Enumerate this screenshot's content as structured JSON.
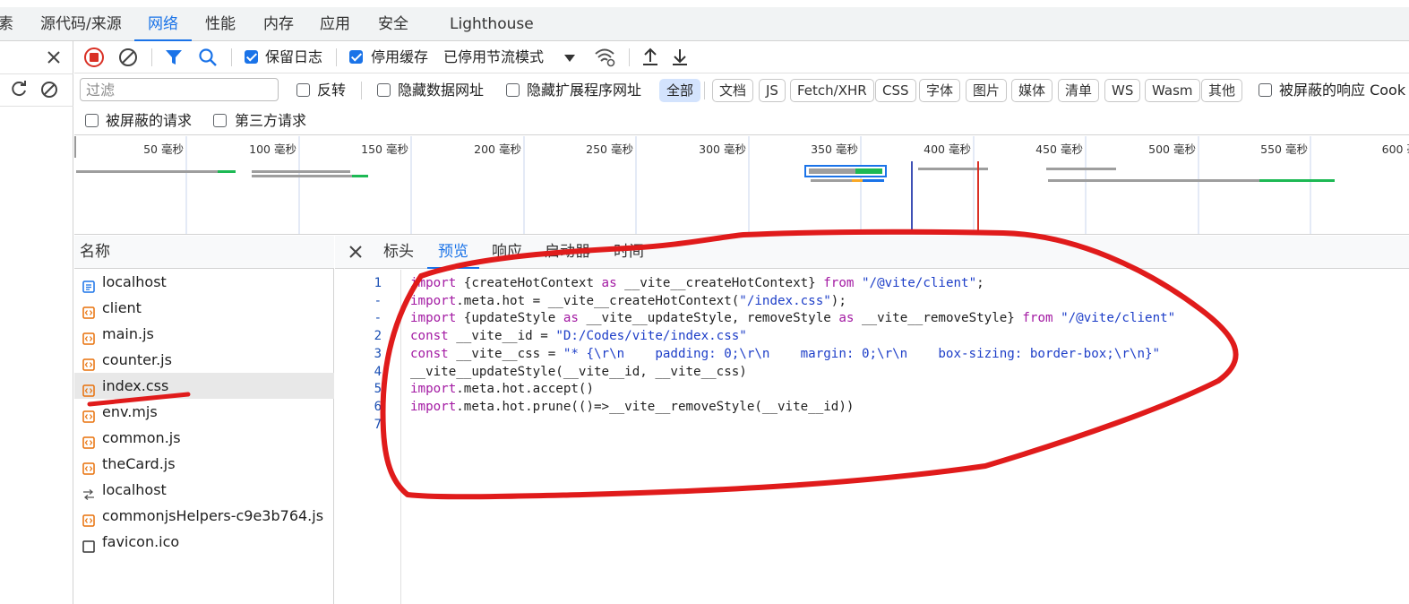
{
  "top_tabs": [
    {
      "label": "素"
    },
    {
      "label": "源代码/来源"
    },
    {
      "label": "网络"
    },
    {
      "label": "性能"
    },
    {
      "label": "内存"
    },
    {
      "label": "应用"
    },
    {
      "label": "安全"
    },
    {
      "label": "Lighthouse"
    }
  ],
  "toolbar": {
    "preserve_log": "保留日志",
    "disable_cache": "停用缓存",
    "throttling": "已停用节流模式"
  },
  "filter": {
    "placeholder": "过滤",
    "invert": "反转",
    "hide_data_urls": "隐藏数据网址",
    "hide_extension_urls": "隐藏扩展程序网址",
    "types": [
      "全部",
      "文档",
      "JS",
      "Fetch/XHR",
      "CSS",
      "字体",
      "图片",
      "媒体",
      "清单",
      "WS",
      "Wasm",
      "其他"
    ],
    "blocked_responses": "被屏蔽的响应 Cook",
    "blocked_requests": "被屏蔽的请求",
    "third_party": "第三方请求"
  },
  "timeline": {
    "ticks": [
      "50 毫秒",
      "100 毫秒",
      "150 毫秒",
      "200 毫秒",
      "250 毫秒",
      "300 毫秒",
      "350 毫秒",
      "400 毫秒",
      "450 毫秒",
      "500 毫秒",
      "550 毫秒",
      "600 毫"
    ]
  },
  "request_list": {
    "header": "名称",
    "rows": [
      {
        "name": "localhost",
        "icon": "document-icon"
      },
      {
        "name": "client",
        "icon": "script-icon"
      },
      {
        "name": "main.js",
        "icon": "script-icon"
      },
      {
        "name": "counter.js",
        "icon": "script-icon"
      },
      {
        "name": "index.css",
        "icon": "script-icon"
      },
      {
        "name": "env.mjs",
        "icon": "script-icon"
      },
      {
        "name": "common.js",
        "icon": "script-icon"
      },
      {
        "name": "theCard.js",
        "icon": "script-icon"
      },
      {
        "name": "localhost",
        "icon": "websocket-icon"
      },
      {
        "name": "commonjsHelpers-c9e3b764.js",
        "icon": "script-icon"
      },
      {
        "name": "favicon.ico",
        "icon": "blank-file-icon"
      }
    ]
  },
  "detail_tabs": [
    {
      "label": "标头"
    },
    {
      "label": "预览"
    },
    {
      "label": "响应"
    },
    {
      "label": "启动器"
    },
    {
      "label": "时间"
    }
  ],
  "code": {
    "line_numbers": [
      "1",
      "-",
      "-",
      "2",
      "3",
      "4",
      "5",
      "6",
      "7"
    ],
    "lines": [
      [
        {
          "t": "kw",
          "s": "import"
        },
        {
          "t": "",
          "s": " {createHotContext "
        },
        {
          "t": "kw",
          "s": "as"
        },
        {
          "t": "",
          "s": " __vite__createHotContext} "
        },
        {
          "t": "kw",
          "s": "from"
        },
        {
          "t": "",
          "s": " "
        },
        {
          "t": "str",
          "s": "\"/@vite/client\""
        },
        {
          "t": "",
          "s": ";"
        }
      ],
      [
        {
          "t": "kw",
          "s": "import"
        },
        {
          "t": "",
          "s": ".meta.hot = __vite__createHotContext("
        },
        {
          "t": "str",
          "s": "\"/index.css\""
        },
        {
          "t": "",
          "s": ");"
        }
      ],
      [
        {
          "t": "kw",
          "s": "import"
        },
        {
          "t": "",
          "s": " {updateStyle "
        },
        {
          "t": "kw",
          "s": "as"
        },
        {
          "t": "",
          "s": " __vite__updateStyle, removeStyle "
        },
        {
          "t": "kw",
          "s": "as"
        },
        {
          "t": "",
          "s": " __vite__removeStyle} "
        },
        {
          "t": "kw",
          "s": "from"
        },
        {
          "t": "",
          "s": " "
        },
        {
          "t": "str",
          "s": "\"/@vite/client\""
        }
      ],
      [
        {
          "t": "kw",
          "s": "const"
        },
        {
          "t": "",
          "s": " __vite__id = "
        },
        {
          "t": "str",
          "s": "\"D:/Codes/vite/index.css\""
        }
      ],
      [
        {
          "t": "kw",
          "s": "const"
        },
        {
          "t": "",
          "s": " __vite__css = "
        },
        {
          "t": "str",
          "s": "\"* {\\r\\n    padding: 0;\\r\\n    margin: 0;\\r\\n    box-sizing: border-box;\\r\\n}\""
        }
      ],
      [
        {
          "t": "",
          "s": "__vite__updateStyle(__vite__id, __vite__css)"
        }
      ],
      [
        {
          "t": "kw",
          "s": "import"
        },
        {
          "t": "",
          "s": ".meta.hot.accept()"
        }
      ],
      [
        {
          "t": "kw",
          "s": "import"
        },
        {
          "t": "",
          "s": ".meta.hot.prune(()=>__vite__removeStyle(__vite__id))"
        }
      ],
      [
        {
          "t": "",
          "s": ""
        }
      ]
    ]
  },
  "colors": {
    "accent": "#1a73e8",
    "annotation": "#e01b1b"
  }
}
